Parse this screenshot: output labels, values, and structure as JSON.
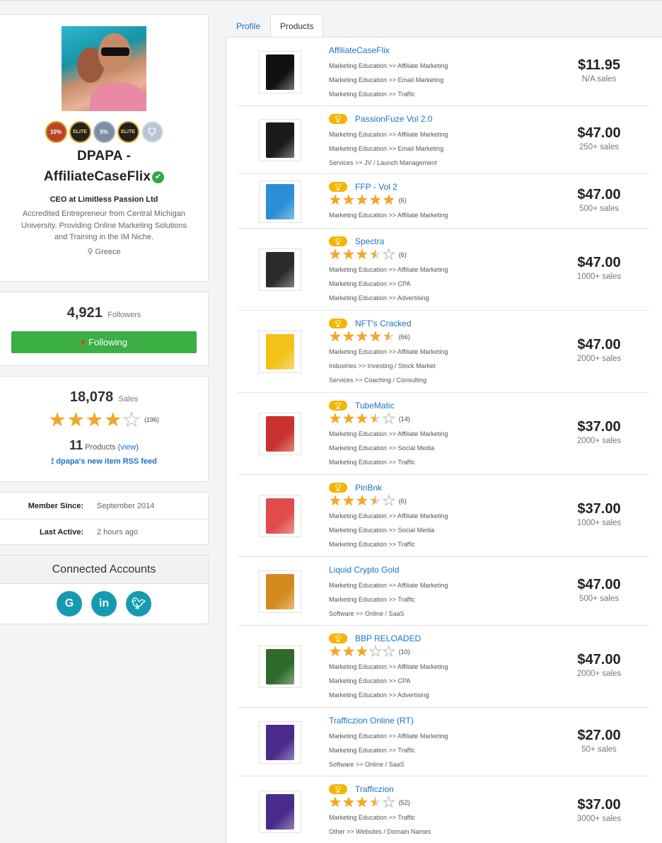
{
  "profile": {
    "name_line1": "DPAPA -",
    "name_line2": "AffiliateCaseFlix",
    "title": "CEO at Limitless Passion Ltd",
    "bio": "Accredited Entrepreneur from Central Michigan University. Providing Online Marketing Solutions and Training in the IM Niche.",
    "location": "Greece",
    "badges": [
      "10%",
      "ELITE",
      "5%",
      "ELITE",
      "shield"
    ]
  },
  "followers": {
    "count": "4,921",
    "label": "Followers",
    "button_label": "Following"
  },
  "stats": {
    "sales_count": "18,078",
    "sales_label": "Sales",
    "rating": 4,
    "rating_count": "(196)",
    "products_count": "11",
    "products_label": "Products (",
    "view_link": "view",
    "products_close": ")",
    "rss_label": "dpapa's new item RSS feed"
  },
  "member": {
    "since_label": "Member Since:",
    "since_value": "September 2014",
    "active_label": "Last Active:",
    "active_value": "2 hours ago"
  },
  "connected": {
    "title": "Connected Accounts",
    "accounts": [
      "google-icon",
      "linkedin-icon",
      "twitter-icon"
    ]
  },
  "tabs": [
    {
      "label": "Profile",
      "active": false
    },
    {
      "label": "Products",
      "active": true
    }
  ],
  "colors": {
    "link": "#1a74c6",
    "follow_button": "#3bae44",
    "social": "#159ab0",
    "star": "#f5a623",
    "trophy": "#f4b400"
  },
  "products": [
    {
      "name": "AffiliateCaseFlix",
      "trophy": false,
      "rating": null,
      "rating_count": "",
      "categories": [
        "Marketing Education >> Affiliate Marketing",
        "Marketing Education >> Email Marketing",
        "Marketing Education >> Traffic"
      ],
      "price": "$11.95",
      "sales": "N/A sales",
      "thumb_color": "#111111"
    },
    {
      "name": "PassionFuze Vol 2.0",
      "trophy": true,
      "rating": null,
      "rating_count": "",
      "categories": [
        "Marketing Education >> Affiliate Marketing",
        "Marketing Education >> Email Marketing",
        "Services >> JV / Launch Management"
      ],
      "price": "$47.00",
      "sales": "250+ sales",
      "thumb_color": "#1a1a1a"
    },
    {
      "name": "FFP - Vol 2",
      "trophy": true,
      "rating": 5,
      "rating_count": "(6)",
      "categories": [
        "Marketing Education >> Affiliate Marketing"
      ],
      "price": "$47.00",
      "sales": "500+ sales",
      "thumb_color": "#2a8fd6"
    },
    {
      "name": "Spectra",
      "trophy": true,
      "rating": 3.5,
      "rating_count": "(6)",
      "categories": [
        "Marketing Education >> Affiliate Marketing",
        "Marketing Education >> CPA",
        "Marketing Education >> Advertising"
      ],
      "price": "$47.00",
      "sales": "1000+ sales",
      "thumb_color": "#2b2b2b"
    },
    {
      "name": "NFT's Cracked",
      "trophy": true,
      "rating": 4.5,
      "rating_count": "(66)",
      "categories": [
        "Marketing Education >> Affiliate Marketing",
        "Industries >> Investing / Stock Market",
        "Services >> Coaching / Consulting"
      ],
      "price": "$47.00",
      "sales": "2000+ sales",
      "thumb_color": "#f2c21b"
    },
    {
      "name": "TubeMatic",
      "trophy": true,
      "rating": 3.5,
      "rating_count": "(14)",
      "categories": [
        "Marketing Education >> Affiliate Marketing",
        "Marketing Education >> Social Media",
        "Marketing Education >> Traffic"
      ],
      "price": "$37.00",
      "sales": "2000+ sales",
      "thumb_color": "#c9322e"
    },
    {
      "name": "PinBnk",
      "trophy": true,
      "rating": 3.5,
      "rating_count": "(6)",
      "categories": [
        "Marketing Education >> Affiliate Marketing",
        "Marketing Education >> Social Media",
        "Marketing Education >> Traffic"
      ],
      "price": "$37.00",
      "sales": "1000+ sales",
      "thumb_color": "#e24b4b"
    },
    {
      "name": "Liquid Crypto Gold",
      "trophy": false,
      "rating": null,
      "rating_count": "",
      "categories": [
        "Marketing Education >> Affiliate Marketing",
        "Marketing Education >> Traffic",
        "Software >> Online / SaaS"
      ],
      "price": "$47.00",
      "sales": "500+ sales",
      "thumb_color": "#d48a1c"
    },
    {
      "name": "BBP RELOADED",
      "trophy": true,
      "rating": 3,
      "rating_count": "(10)",
      "categories": [
        "Marketing Education >> Affiliate Marketing",
        "Marketing Education >> CPA",
        "Marketing Education >> Advertising"
      ],
      "price": "$47.00",
      "sales": "2000+ sales",
      "thumb_color": "#2f6a2a"
    },
    {
      "name": "Trafficzion Online (RT)",
      "trophy": false,
      "rating": null,
      "rating_count": "",
      "categories": [
        "Marketing Education >> Affiliate Marketing",
        "Marketing Education >> Traffic",
        "Software >> Online / SaaS"
      ],
      "price": "$27.00",
      "sales": "50+ sales",
      "thumb_color": "#4a2a8a"
    },
    {
      "name": "Trafficzion",
      "trophy": true,
      "rating": 3.5,
      "rating_count": "(52)",
      "categories": [
        "Marketing Education >> Traffic",
        "Other >> Websites / Domain Names"
      ],
      "price": "$37.00",
      "sales": "3000+ sales",
      "thumb_color": "#4a2a8a"
    }
  ]
}
